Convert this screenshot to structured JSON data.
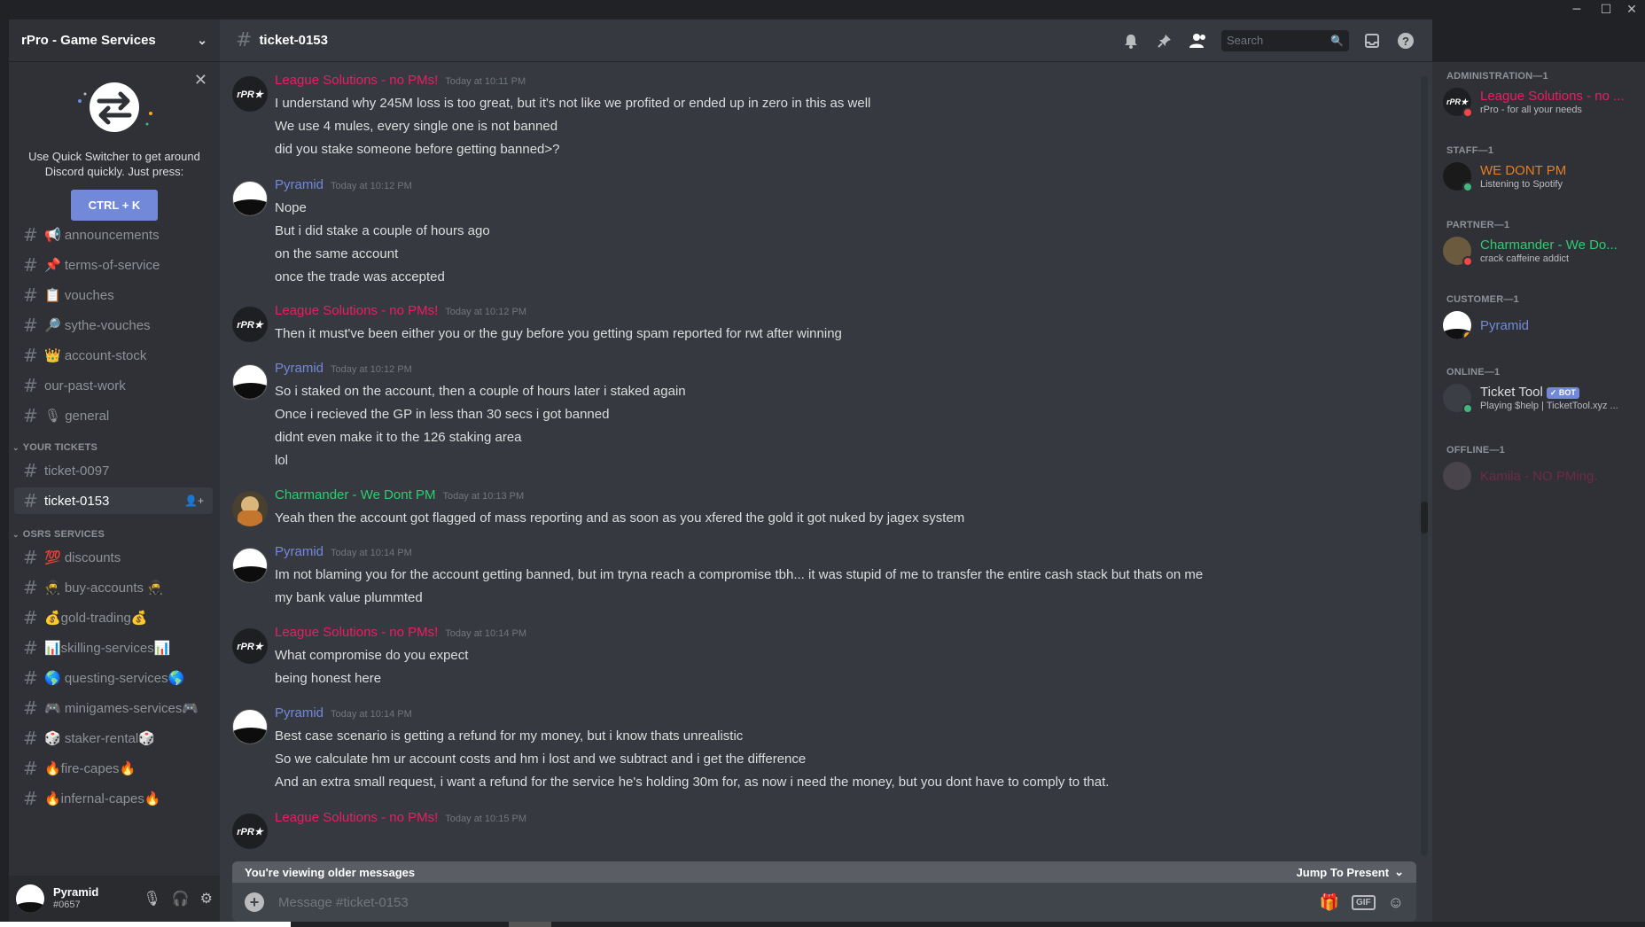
{
  "window": {
    "controls": [
      "─",
      "☐",
      "✕"
    ]
  },
  "server": {
    "name": "rPro - Game Services"
  },
  "quick_switcher": {
    "text": "Use Quick Switcher to get around Discord quickly. Just press:",
    "shortcut": "CTRL + K"
  },
  "channels": [
    {
      "label": "📢 announcements"
    },
    {
      "label": "📌 terms-of-service"
    },
    {
      "label": "📋 vouches"
    },
    {
      "label": "🔎 sythe-vouches"
    },
    {
      "label": "👑 account-stock"
    },
    {
      "label": "our-past-work"
    },
    {
      "label": "🎙 general"
    }
  ],
  "categories": {
    "tickets": "YOUR TICKETS",
    "osrs": "OSRS SERVICES"
  },
  "tickets": [
    {
      "label": "ticket-0097"
    },
    {
      "label": "ticket-0153"
    }
  ],
  "osrs_channels": [
    {
      "label": "💯 discounts"
    },
    {
      "label": "🥷 buy-accounts 🥷"
    },
    {
      "label": "💰gold-trading💰"
    },
    {
      "label": "📊skilling-services📊"
    },
    {
      "label": "🌎 questing-services🌎"
    },
    {
      "label": "🎮 minigames-services🎮"
    },
    {
      "label": "🎲 staker-rental🎲"
    },
    {
      "label": "🔥fire-capes🔥"
    },
    {
      "label": "🔥infernal-capes🔥"
    }
  ],
  "user": {
    "name": "Pyramid",
    "tag": "#0657"
  },
  "chat": {
    "channel": "ticket-0153",
    "search_placeholder": "Search",
    "older_notice": "You're viewing older messages",
    "jump": "Jump To Present",
    "input_placeholder": "Message #ticket-0153",
    "gif": "GIF"
  },
  "messages": [
    {
      "author": "League Solutions - no PMs!",
      "time": "Today at 10:11 PM",
      "lines": [
        "I understand why 245M loss is too great, but it's not like we profited or ended up in zero in this as well",
        "We use 4 mules, every single one is not banned",
        "did you stake someone before getting banned>?"
      ]
    },
    {
      "author": "Pyramid",
      "time": "Today at 10:12 PM",
      "lines": [
        "Nope",
        "But i did stake a couple of hours ago",
        "on the same account",
        "once the trade was accepted"
      ]
    },
    {
      "author": "League Solutions - no PMs!",
      "time": "Today at 10:12 PM",
      "lines": [
        "Then it must've been either you or the guy before you getting spam reported for rwt after winning"
      ]
    },
    {
      "author": "Pyramid",
      "time": "Today at 10:12 PM",
      "lines": [
        "So i staked on the account, then a couple of hours later i staked again",
        "Once i recieved the GP in less than 30 secs i got banned",
        "didnt even make it to the 126 staking area",
        "lol"
      ]
    },
    {
      "author": "Charmander - We Dont PM",
      "time": "Today at 10:13 PM",
      "lines": [
        "Yeah then the account got flagged of mass reporting and as soon as you xfered the gold it got nuked by jagex system"
      ]
    },
    {
      "author": "Pyramid",
      "time": "Today at 10:14 PM",
      "lines": [
        "Im not blaming you for the account getting banned, but im tryna reach a compromise tbh... it was stupid of me to transfer the entire cash stack but thats on me",
        "my bank value plummted"
      ]
    },
    {
      "author": "League Solutions - no PMs!",
      "time": "Today at 10:14 PM",
      "lines": [
        "What compromise do you expect",
        "being honest here"
      ]
    },
    {
      "author": "Pyramid",
      "time": "Today at 10:14 PM",
      "lines": [
        "Best case scenario is getting a refund for my money, but i know thats unrealistic",
        "So we calculate hm ur account costs and hm i lost and we subtract and i get the difference",
        "And an extra small request, i want a refund for the service he's holding 30m for, as now i need the money, but you dont have to comply to that."
      ]
    },
    {
      "author": "League Solutions - no PMs!",
      "time": "Today at 10:15 PM",
      "lines": []
    }
  ],
  "members": {
    "groups": [
      {
        "title": "ADMINISTRATION—1",
        "name": "League Solutions - no ...",
        "activity": "rPro - for all your needs"
      },
      {
        "title": "STAFF—1",
        "name": "WE DONT PM",
        "activity": "Listening to Spotify"
      },
      {
        "title": "PARTNER—1",
        "name": "Charmander - We Do...",
        "activity": "crack caffeine addict"
      },
      {
        "title": "CUSTOMER—1",
        "name": "Pyramid",
        "activity": ""
      },
      {
        "title": "ONLINE—1",
        "name": "Ticket Tool",
        "activity": "Playing $help | TicketTool.xyz ..."
      },
      {
        "title": "OFFLINE—1",
        "name": "Kamila - NO PMing.",
        "activity": ""
      }
    ],
    "bot_badge": "✓ BOT"
  },
  "colors": {
    "accent": "#7289da",
    "admin": "#e91e63",
    "partner": "#2ecc71",
    "staff": "#e67e22"
  }
}
